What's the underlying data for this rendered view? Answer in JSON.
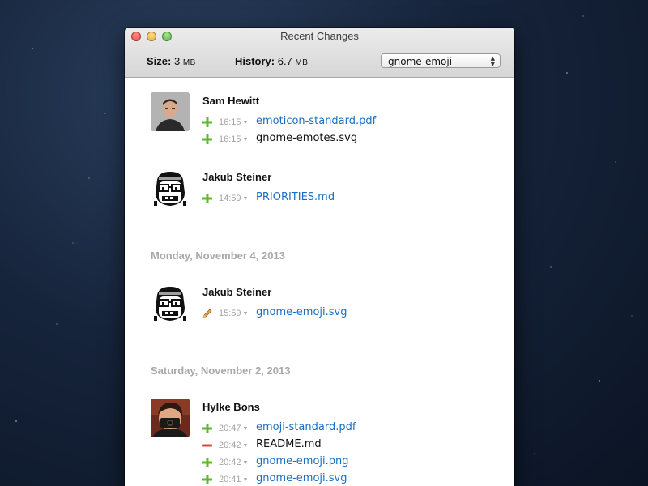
{
  "window": {
    "title": "Recent Changes"
  },
  "infobar": {
    "size_label": "Size:",
    "size_value": "3",
    "size_unit": "MB",
    "history_label": "History:",
    "history_value": "6.7",
    "history_unit": "MB",
    "repo_select": "gnome-emoji"
  },
  "groups": [
    {
      "date": "",
      "author": "Sam Hewitt",
      "files": [
        {
          "action": "added",
          "time": "16:15",
          "name": "emoticon-standard.pdf",
          "link": true
        },
        {
          "action": "added",
          "time": "16:15",
          "name": "gnome-emotes.svg",
          "link": false
        }
      ]
    },
    {
      "date": "",
      "author": "Jakub Steiner",
      "files": [
        {
          "action": "added",
          "time": "14:59",
          "name": "PRIORITIES.md",
          "link": true
        }
      ]
    },
    {
      "date": "Monday, November 4, 2013",
      "author": "Jakub Steiner",
      "files": [
        {
          "action": "edited",
          "time": "15:59",
          "name": "gnome-emoji.svg",
          "link": true
        }
      ]
    },
    {
      "date": "Saturday, November 2, 2013",
      "author": "Hylke Bons",
      "files": [
        {
          "action": "added",
          "time": "20:47",
          "name": "emoji-standard.pdf",
          "link": true
        },
        {
          "action": "removed",
          "time": "20:42",
          "name": "README.md",
          "link": false
        },
        {
          "action": "added",
          "time": "20:42",
          "name": "gnome-emoji.png",
          "link": true
        },
        {
          "action": "added",
          "time": "20:41",
          "name": "gnome-emoji.svg",
          "link": true
        }
      ]
    }
  ],
  "colors": {
    "link": "#1a6fc4",
    "added": "#5cb82e",
    "removed": "#e0443e",
    "date_heading": "#a8a8a8"
  }
}
